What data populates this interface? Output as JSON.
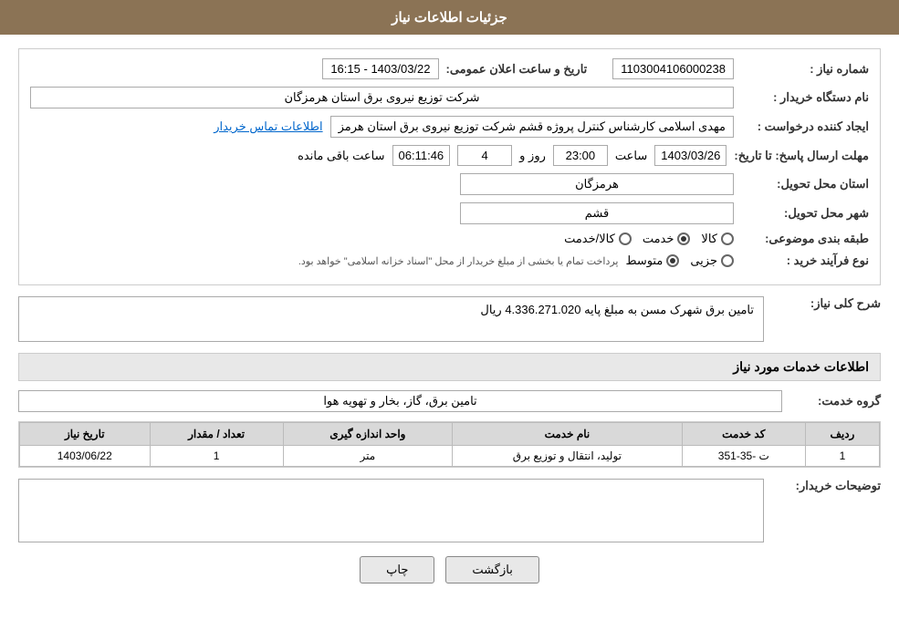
{
  "header": {
    "title": "جزئیات اطلاعات نیاز"
  },
  "fields": {
    "shomare_niaz_label": "شماره نیاز :",
    "shomare_niaz_value": "1103004106000238",
    "nam_dastgah_label": "نام دستگاه خریدار :",
    "nam_dastgah_value": "شرکت توزیع نیروی برق استان هرمزگان",
    "ijad_konande_label": "ایجاد کننده درخواست :",
    "ijad_konande_value": "مهدی اسلامی کارشناس کنترل پروژه قشم شرکت توزیع نیروی برق استان هرمز",
    "ijad_konande_link": "اطلاعات تماس خریدار",
    "mohlat_ersal_label": "مهلت ارسال پاسخ: تا تاریخ:",
    "mohlat_date": "1403/03/26",
    "mohlat_saat_label": "ساعت",
    "mohlat_saat": "23:00",
    "mohlat_roz_label": "روز و",
    "mohlat_roz": "4",
    "mohlat_baqi_label": "ساعت باقی مانده",
    "mohlat_baqi": "06:11:46",
    "tarikh_label": "تاریخ و ساعت اعلان عمومی:",
    "tarikh_value": "1403/03/22 - 16:15",
    "ostan_tahvil_label": "استان محل تحویل:",
    "ostan_tahvil_value": "هرمزگان",
    "shahr_tahvil_label": "شهر محل تحویل:",
    "shahr_tahvil_value": "قشم",
    "tabaqe_label": "طبقه بندی موضوعی:",
    "tabaqe_options": [
      {
        "label": "کالا",
        "selected": false
      },
      {
        "label": "خدمت",
        "selected": true
      },
      {
        "label": "کالا/خدمت",
        "selected": false
      }
    ],
    "nooe_farayand_label": "نوع فرآیند خرید :",
    "nooe_farayand_options": [
      {
        "label": "جزیی",
        "selected": false
      },
      {
        "label": "متوسط",
        "selected": true
      }
    ],
    "nooe_farayand_note": "پرداخت تمام یا بخشی از مبلغ خریدار از محل \"اسناد خزانه اسلامی\" خواهد بود.",
    "sharh_label": "شرح کلی نیاز:",
    "sharh_value": "تامین برق شهرک مسن به مبلغ پایه 4.336.271.020 ریال",
    "khadamat_label": "اطلاعات خدمات مورد نیاز",
    "gorohe_khadamat_label": "گروه خدمت:",
    "gorohe_khadamat_value": "تامین برق، گاز، بخار و تهویه هوا",
    "table": {
      "headers": [
        "ردیف",
        "کد خدمت",
        "نام خدمت",
        "واحد اندازه گیری",
        "تعداد / مقدار",
        "تاریخ نیاز"
      ],
      "rows": [
        {
          "radif": "1",
          "code": "ت -35-351",
          "name": "تولید، انتقال و توزیع برق",
          "vahed": "متر",
          "tedad": "1",
          "tarikh": "1403/06/22"
        }
      ]
    },
    "tozihat_label": "توضیحات خریدار:",
    "tozihat_value": ""
  },
  "buttons": {
    "back_label": "بازگشت",
    "print_label": "چاپ"
  }
}
